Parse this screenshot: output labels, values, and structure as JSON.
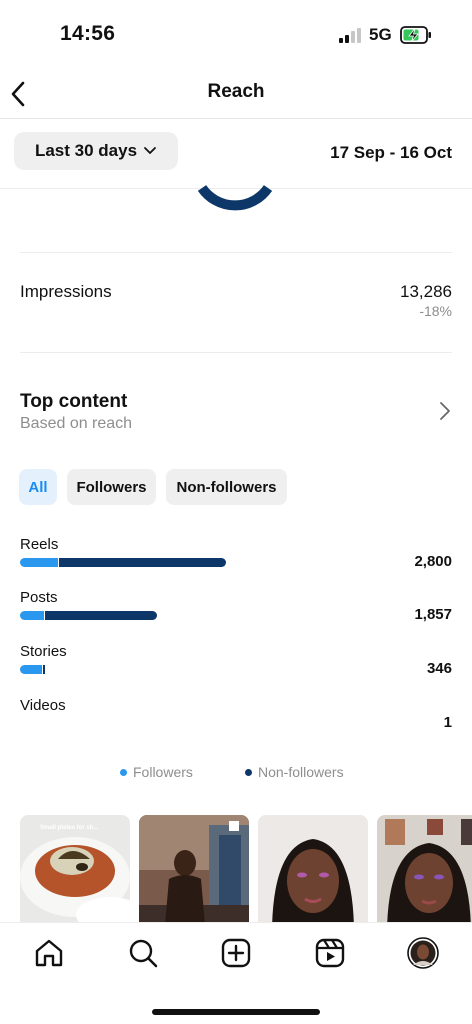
{
  "status_bar": {
    "time": "14:56",
    "network": "5G"
  },
  "header": {
    "title": "Reach"
  },
  "filter": {
    "range_label": "Last 30 days",
    "date_range": "17 Sep - 16 Oct"
  },
  "impressions": {
    "label": "Impressions",
    "value": "13,286",
    "change": "-18%"
  },
  "top_content": {
    "title": "Top content",
    "subtitle": "Based on reach",
    "chips": [
      "All",
      "Followers",
      "Non-followers"
    ],
    "active_chip": "All"
  },
  "breakdown": [
    {
      "label": "Reels",
      "value": "2,800",
      "total": 2800,
      "followers_share": 0.19
    },
    {
      "label": "Posts",
      "value": "1,857",
      "total": 1857,
      "followers_share": 0.18
    },
    {
      "label": "Stories",
      "value": "346",
      "total": 346,
      "followers_share": 0.9
    },
    {
      "label": "Videos",
      "value": "1",
      "total": 1,
      "followers_share": 0
    }
  ],
  "legend": {
    "followers": "Followers",
    "non_followers": "Non-followers"
  },
  "colors": {
    "followers": "#2a98ee",
    "non_followers": "#0d3768",
    "active_chip_text": "#1a8cf0",
    "active_chip_bg": "#e4f1fd"
  },
  "thumbnails": [
    {
      "icon": "food-plate-thumbnail",
      "caption": "Small plates for sh..."
    },
    {
      "icon": "person-in-restaurant-thumbnail"
    },
    {
      "icon": "portrait-selfie-thumbnail"
    },
    {
      "icon": "portrait-selfie-thumbnail-2"
    }
  ],
  "tabs": [
    "home-icon",
    "search-icon",
    "create-icon",
    "reels-icon",
    "profile-avatar"
  ]
}
